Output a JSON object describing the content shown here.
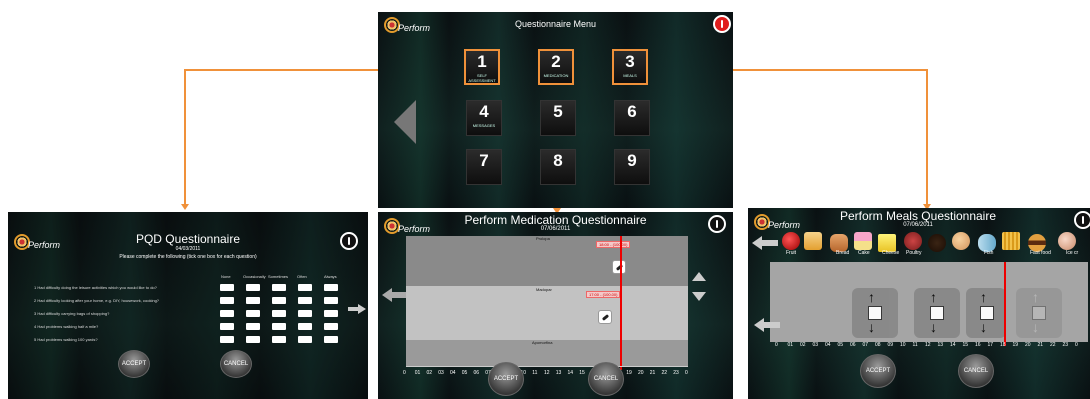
{
  "colors": {
    "accent": "#f0913a",
    "power": "#e01e1e",
    "timeline": "#e00000"
  },
  "menu": {
    "logo": "Perform",
    "title": "Questionnaire Menu",
    "tiles": [
      {
        "num": "1",
        "sub": "SELF ASSESSMENT"
      },
      {
        "num": "2",
        "sub": "MEDICATION"
      },
      {
        "num": "3",
        "sub": "MEALS"
      },
      {
        "num": "4",
        "sub": "MESSAGES"
      },
      {
        "num": "5",
        "sub": ""
      },
      {
        "num": "6",
        "sub": ""
      },
      {
        "num": "7",
        "sub": ""
      },
      {
        "num": "8",
        "sub": ""
      },
      {
        "num": "9",
        "sub": ""
      }
    ]
  },
  "pqd": {
    "logo": "Perform",
    "title": "PQD Questionnaire",
    "date": "04/03/2011",
    "instruction": "Please complete the following (tick one box for each question)",
    "columns": [
      "None",
      "Occasionally",
      "Sometimes",
      "Often",
      "Always"
    ],
    "questions": [
      "1  Had difficulty doing the leisure activities which you would like to do?",
      "2  Had difficulty looking after your home, e.g. DIY, housework, cooking?",
      "3  Had difficulty carrying bags of shopping?",
      "4  Had problems walking half a mile?",
      "5  Had problems walking 100 yards?"
    ],
    "accept": "ACCEPT",
    "cancel": "CANCEL"
  },
  "medication": {
    "logo": "Perform",
    "title": "Perform Medication Questionnaire",
    "date": "07/06/2011",
    "bands": [
      {
        "name": "Prolopa",
        "time": "18:00 - (100.00)"
      },
      {
        "name": "Madopar",
        "time": "17:00 - (100.00)"
      },
      {
        "name": "Apomorfina",
        "time": ""
      }
    ],
    "hours": [
      "0",
      "01",
      "02",
      "03",
      "04",
      "05",
      "06",
      "07",
      "08",
      "09",
      "10",
      "11",
      "12",
      "13",
      "14",
      "15",
      "16",
      "17",
      "18",
      "19",
      "20",
      "21",
      "22",
      "23",
      "0"
    ],
    "accept": "ACCEPT",
    "cancel": "CANCEL"
  },
  "meals": {
    "logo": "Perform",
    "title": "Perform Meals Questionnaire",
    "date": "07/06/2011",
    "foods": [
      "Fruit",
      "Bread",
      "Cake",
      "Cheese",
      "Poultry",
      "Fish",
      "Fast food",
      "Ice cr"
    ],
    "hours": [
      "0",
      "01",
      "02",
      "03",
      "04",
      "05",
      "06",
      "07",
      "08",
      "09",
      "10",
      "11",
      "12",
      "13",
      "14",
      "15",
      "16",
      "17",
      "18",
      "19",
      "20",
      "21",
      "22",
      "23",
      "0"
    ],
    "accept": "ACCEPT",
    "cancel": "CANCEL"
  }
}
